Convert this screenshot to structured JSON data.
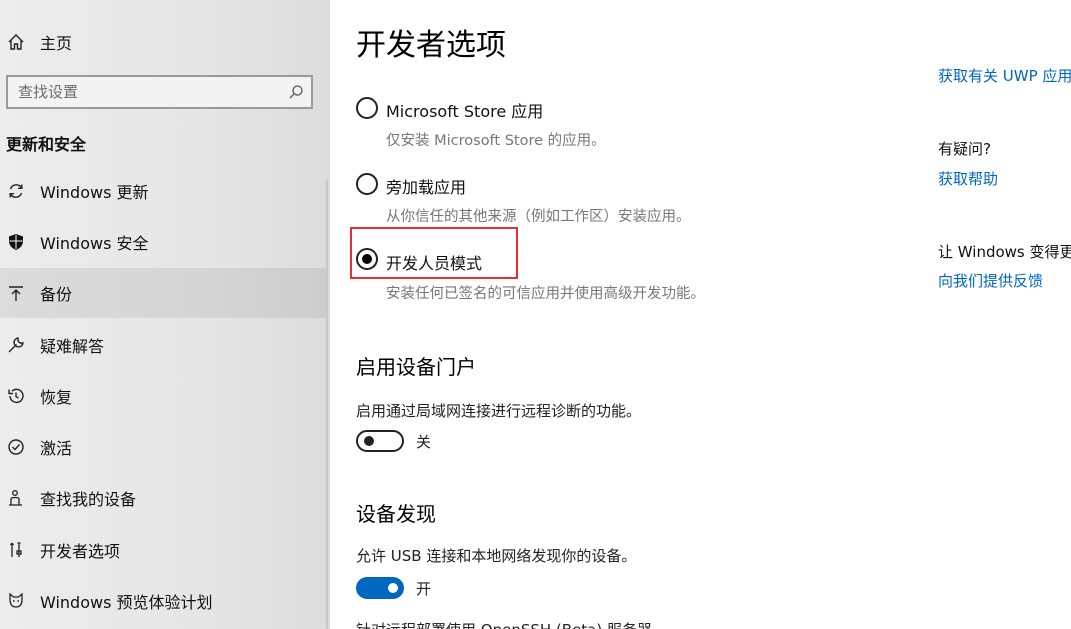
{
  "sidebar": {
    "home_label": "主页",
    "search_placeholder": "查找设置",
    "section_title": "更新和安全",
    "items": [
      {
        "label": "Windows 更新",
        "icon": "refresh-icon"
      },
      {
        "label": "Windows 安全",
        "icon": "shield-icon"
      },
      {
        "label": "备份",
        "icon": "backup-icon"
      },
      {
        "label": "疑难解答",
        "icon": "wrench-icon"
      },
      {
        "label": "恢复",
        "icon": "recovery-icon"
      },
      {
        "label": "激活",
        "icon": "check-circle-icon"
      },
      {
        "label": "查找我的设备",
        "icon": "person-location-icon"
      },
      {
        "label": "开发者选项",
        "icon": "developer-tools-icon"
      },
      {
        "label": "Windows 预览体验计划",
        "icon": "insider-cat-icon"
      }
    ],
    "selected_item": "备份"
  },
  "main": {
    "title": "开发者选项",
    "options": [
      {
        "label": "Microsoft Store 应用",
        "description": "仅安装 Microsoft Store 的应用。",
        "checked": false
      },
      {
        "label": "旁加载应用",
        "description": "从你信任的其他来源（例如工作区）安装应用。",
        "checked": false
      },
      {
        "label": "开发人员模式",
        "description": "安装任何已签名的可信应用并使用高级开发功能。",
        "checked": true
      }
    ],
    "device_portal": {
      "heading": "启用设备门户",
      "description": "启用通过局域网连接进行远程诊断的功能。",
      "toggle_label": "关",
      "enabled": false
    },
    "device_discovery": {
      "heading": "设备发现",
      "description": "允许 USB 连接和本地网络发现你的设备。",
      "toggle_label": "开",
      "enabled": true
    },
    "cut_off_text": "针对远程部署使用 OpenSSH (Beta) 服务器"
  },
  "right": {
    "uwp_link": "获取有关 UWP 应用",
    "question": "有疑问?",
    "help_link": "获取帮助",
    "improve": "让 Windows 变得更",
    "feedback_link": "向我们提供反馈"
  },
  "colors": {
    "accent": "#0067c0",
    "highlight_border": "#e0303a"
  }
}
